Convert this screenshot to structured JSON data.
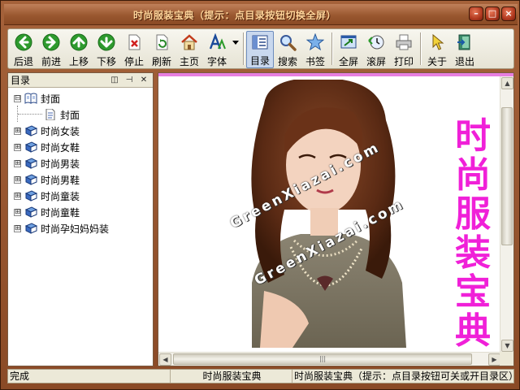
{
  "window": {
    "title": "时尚服装宝典（提示：点目录按钮切换全屏）",
    "controls": [
      "–",
      "□",
      "×"
    ]
  },
  "toolbar": {
    "items": [
      {
        "label": "后退",
        "icon": "back-arrow-icon"
      },
      {
        "label": "前进",
        "icon": "forward-arrow-icon"
      },
      {
        "label": "上移",
        "icon": "up-arrow-icon"
      },
      {
        "label": "下移",
        "icon": "down-arrow-icon"
      },
      {
        "label": "停止",
        "icon": "stop-icon"
      },
      {
        "label": "刷新",
        "icon": "refresh-icon"
      },
      {
        "label": "主页",
        "icon": "home-icon"
      },
      {
        "label": "字体",
        "icon": "font-icon"
      },
      {
        "label": "目录",
        "icon": "contents-icon",
        "active": true
      },
      {
        "label": "搜索",
        "icon": "search-icon"
      },
      {
        "label": "书签",
        "icon": "bookmark-star-icon"
      },
      {
        "label": "全屏",
        "icon": "fullscreen-icon"
      },
      {
        "label": "滚屏",
        "icon": "autoscroll-icon"
      },
      {
        "label": "打印",
        "icon": "print-icon"
      },
      {
        "label": "关于",
        "icon": "about-pointer-icon"
      },
      {
        "label": "退出",
        "icon": "exit-icon"
      }
    ]
  },
  "sidebar": {
    "title": "目录",
    "tree": {
      "root": {
        "label": "封面",
        "expander": "⊟",
        "children": [
          {
            "label": "封面"
          }
        ]
      },
      "items": [
        {
          "label": "时尚女装",
          "expander": "⊞"
        },
        {
          "label": "时尚女鞋",
          "expander": "⊞"
        },
        {
          "label": "时尚男装",
          "expander": "⊞"
        },
        {
          "label": "时尚男鞋",
          "expander": "⊞"
        },
        {
          "label": "时尚童装",
          "expander": "⊞"
        },
        {
          "label": "时尚童鞋",
          "expander": "⊞"
        },
        {
          "label": "时尚孕妇妈妈装",
          "expander": "⊞"
        }
      ]
    }
  },
  "content": {
    "vertical_title": [
      "时",
      "尚",
      "服",
      "装",
      "宝",
      "典"
    ],
    "watermark": "GreenXiazai.com",
    "colors": {
      "title": "#f020d8",
      "accent_line": "#e77ee0"
    }
  },
  "statusbar": {
    "status": "完成",
    "doc_title": "时尚服装宝典",
    "hint": "时尚服装宝典（提示：点目录按钮可关或开目录区）"
  }
}
